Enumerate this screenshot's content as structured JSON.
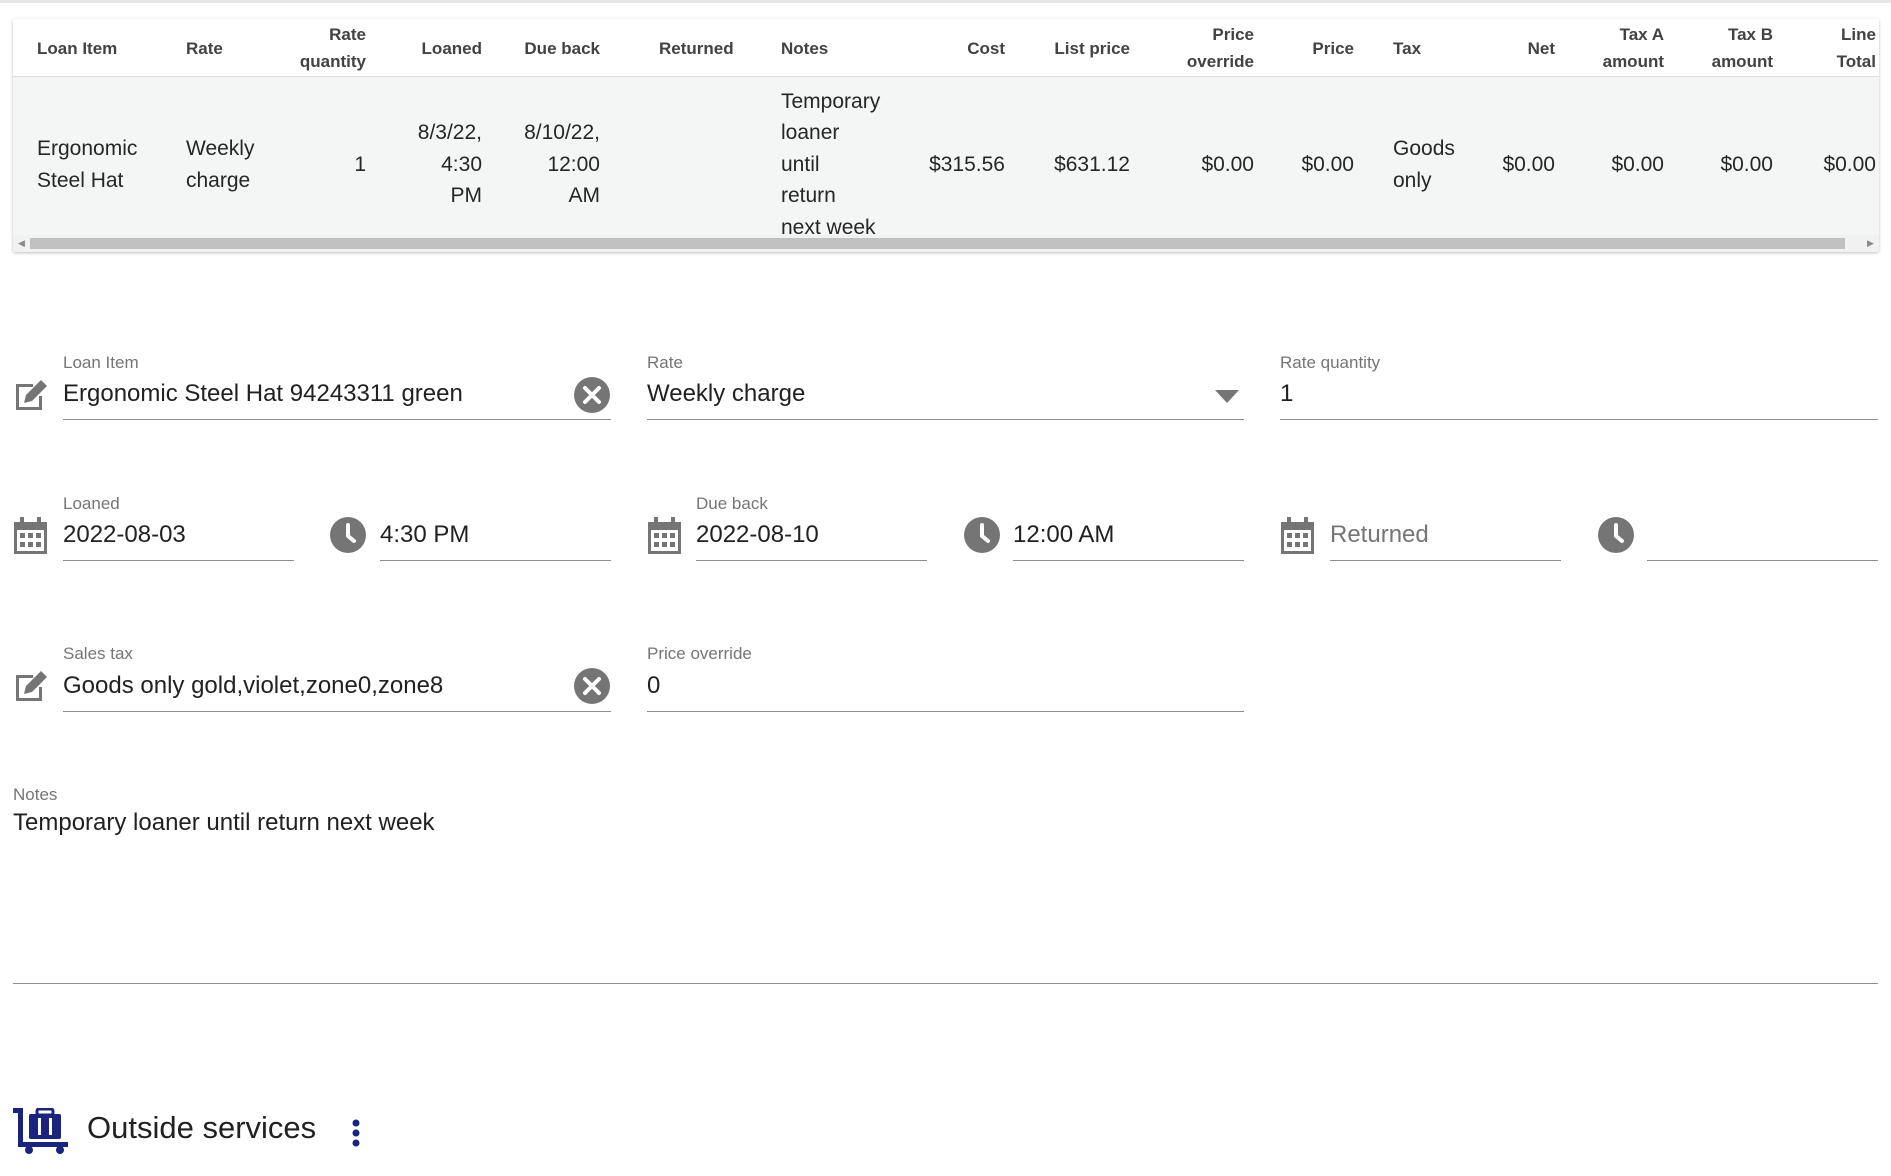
{
  "table": {
    "headers": {
      "loan_item": "Loan Item",
      "rate": "Rate",
      "rate_quantity": "Rate\nquantity",
      "loaned": "Loaned",
      "due_back": "Due back",
      "returned": "Returned",
      "notes": "Notes",
      "cost": "Cost",
      "list_price": "List price",
      "price_override": "Price\noverride",
      "price": "Price",
      "tax": "Tax",
      "net": "Net",
      "tax_a": "Tax A\namount",
      "tax_b": "Tax B\namount",
      "line_total": "Line\nTotal"
    },
    "row": {
      "loan_item": "Ergonomic\nSteel Hat",
      "rate": "Weekly\ncharge",
      "rate_quantity": "1",
      "loaned": "8/3/22,\n4:30\nPM",
      "due_back": "8/10/22,\n12:00\nAM",
      "returned": "",
      "notes": "Temporary\nloaner\nuntil\nreturn\nnext week",
      "cost": "$315.56",
      "list_price": "$631.12",
      "price_override": "$0.00",
      "price": "$0.00",
      "tax": "Goods\nonly",
      "net": "$0.00",
      "tax_a": "$0.00",
      "tax_b": "$0.00",
      "line_total": "$0.00"
    }
  },
  "form": {
    "loan_item": {
      "label": "Loan Item",
      "value": "Ergonomic Steel Hat 94243311 green"
    },
    "rate": {
      "label": "Rate",
      "value": "Weekly charge"
    },
    "rate_quantity": {
      "label": "Rate quantity",
      "value": "1"
    },
    "loaned": {
      "label": "Loaned",
      "date": "2022-08-03",
      "time": "4:30 PM"
    },
    "due_back": {
      "label": "Due back",
      "date": "2022-08-10",
      "time": "12:00 AM"
    },
    "returned": {
      "placeholder": "Returned",
      "time": ""
    },
    "sales_tax": {
      "label": "Sales tax",
      "value": "Goods only gold,violet,zone0,zone8"
    },
    "price_override": {
      "label": "Price override",
      "value": "0"
    },
    "notes": {
      "label": "Notes",
      "value": "Temporary loaner until return next week"
    }
  },
  "section": {
    "title": "Outside services"
  },
  "icons": {
    "edit": "edit-icon",
    "clear": "clear-circle-icon",
    "dropdown": "caret-down-icon",
    "calendar": "calendar-icon",
    "clock": "clock-icon",
    "services": "luggage-cart-icon",
    "more": "more-vertical-icon"
  },
  "colors": {
    "icon_gray": "#757575",
    "navy": "#1a237e"
  }
}
